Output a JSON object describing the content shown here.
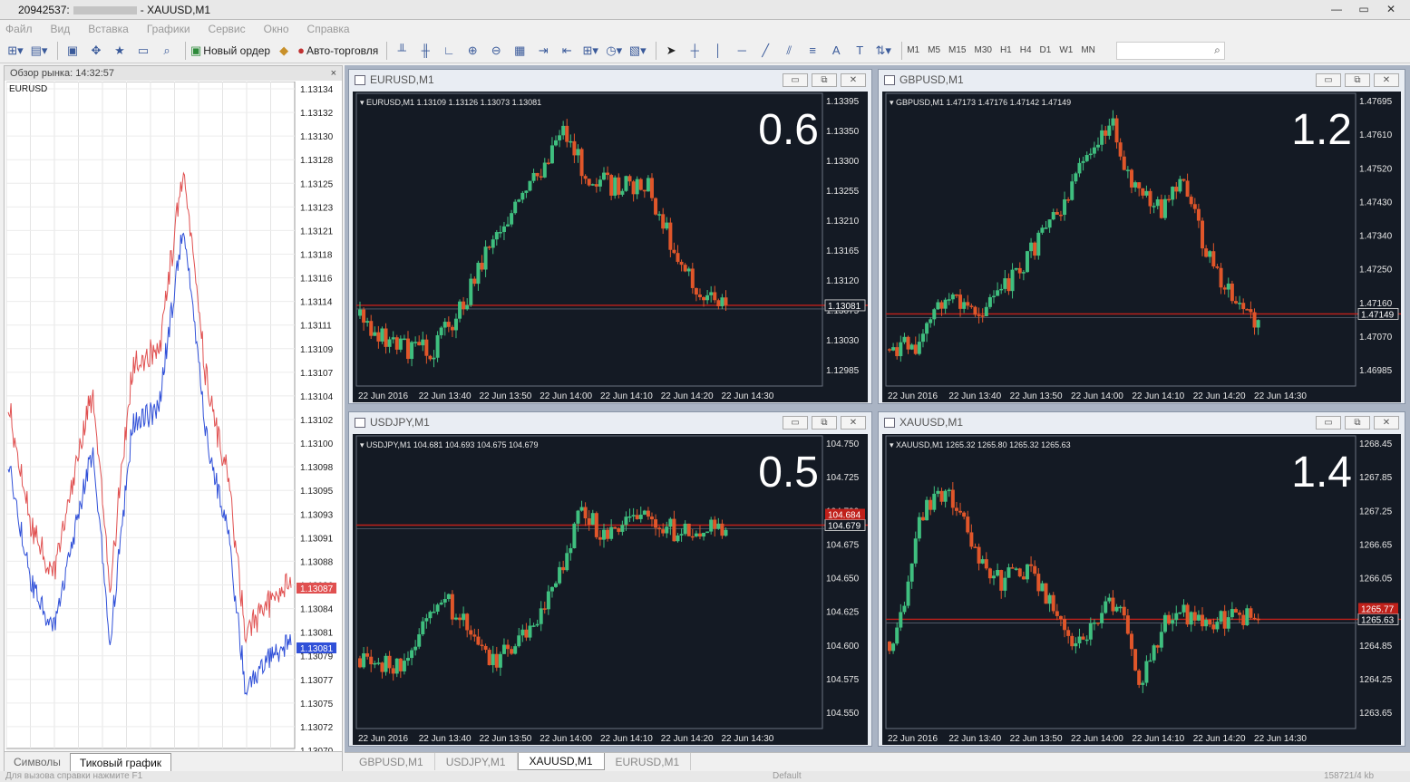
{
  "window": {
    "title_account": "20942537:",
    "title_separator": "-",
    "title_symbol": "XAUUSD,M1",
    "minimize": "—",
    "restore": "▭",
    "close": "✕"
  },
  "menu": [
    "Файл",
    "Вид",
    "Вставка",
    "Графики",
    "Сервис",
    "Окно",
    "Справка"
  ],
  "toolbar": {
    "new_order": "Новый ордер",
    "autotrading": "Авто-торговля",
    "timeframes": [
      "M1",
      "M5",
      "M15",
      "M30",
      "H1",
      "H4",
      "D1",
      "W1",
      "MN"
    ]
  },
  "market_watch": {
    "header": "Обзор рынка: 14:32:57",
    "close": "×",
    "symbol": "EURUSD",
    "tabs": [
      "Символы",
      "Тиковый график"
    ],
    "active_tab": 1,
    "price_labels": [
      "1.13134",
      "1.13132",
      "1.13130",
      "1.13128",
      "1.13125",
      "1.13123",
      "1.13121",
      "1.13118",
      "1.13116",
      "1.13114",
      "1.13111",
      "1.13109",
      "1.13107",
      "1.13104",
      "1.13102",
      "1.13100",
      "1.13098",
      "1.13095",
      "1.13093",
      "1.13091",
      "1.13088",
      "1.13086",
      "1.13084",
      "1.13081",
      "1.13079",
      "1.13077",
      "1.13075",
      "1.13072",
      "1.13070"
    ],
    "ask_tag": "1.13087",
    "bid_tag": "1.13081",
    "ask_color": "#e05050",
    "bid_color": "#3050d8"
  },
  "colors": {
    "chart_bg": "#141a24",
    "bull": "#3fbf7f",
    "bear": "#e0562a",
    "level_line": "#c0201a",
    "axis_text": "#e8e8e8",
    "spread_bg": "#c0201a"
  },
  "charts": [
    {
      "title": "EURUSD,M1",
      "info": "▾ EURUSD,M1  1.13109 1.13126 1.13073 1.13081",
      "spread": "0.6",
      "current": "1.13081",
      "current2": "",
      "prices": [
        "1.13395",
        "1.13350",
        "1.13300",
        "1.13255",
        "1.13210",
        "1.13165",
        "1.13120",
        "1.13075",
        "1.13030",
        "1.12985"
      ],
      "times": [
        "22 Jun 2016",
        "22 Jun 13:40",
        "22 Jun 13:50",
        "22 Jun 14:00",
        "22 Jun 14:10",
        "22 Jun 14:20",
        "22 Jun 14:30"
      ],
      "seed": 3
    },
    {
      "title": "GBPUSD,M1",
      "info": "▾ GBPUSD,M1  1.47173 1.47176 1.47142 1.47149",
      "spread": "1.2",
      "current": "1.47149",
      "current2": "",
      "prices": [
        "1.47695",
        "1.47610",
        "1.47520",
        "1.47430",
        "1.47340",
        "1.47250",
        "1.47160",
        "1.47070",
        "1.46985"
      ],
      "times": [
        "22 Jun 2016",
        "22 Jun 13:40",
        "22 Jun 13:50",
        "22 Jun 14:00",
        "22 Jun 14:10",
        "22 Jun 14:20",
        "22 Jun 14:30"
      ],
      "seed": 7
    },
    {
      "title": "USDJPY,M1",
      "info": "▾ USDJPY,M1  104.681 104.693 104.675 104.679",
      "spread": "0.5",
      "current": "104.679",
      "current2": "104.684",
      "prices": [
        "104.750",
        "104.725",
        "104.700",
        "104.675",
        "104.650",
        "104.625",
        "104.600",
        "104.575",
        "104.550"
      ],
      "times": [
        "22 Jun 2016",
        "22 Jun 13:40",
        "22 Jun 13:50",
        "22 Jun 14:00",
        "22 Jun 14:10",
        "22 Jun 14:20",
        "22 Jun 14:30"
      ],
      "seed": 11
    },
    {
      "title": "XAUUSD,M1",
      "info": "▾ XAUUSD,M1  1265.32 1265.80 1265.32 1265.63",
      "spread": "1.4",
      "current": "1265.63",
      "current2": "1265.77",
      "prices": [
        "1268.45",
        "1267.85",
        "1267.25",
        "1266.65",
        "1266.05",
        "1265.45",
        "1264.85",
        "1264.25",
        "1263.65"
      ],
      "times": [
        "22 Jun 2016",
        "22 Jun 13:40",
        "22 Jun 13:50",
        "22 Jun 14:00",
        "22 Jun 14:10",
        "22 Jun 14:20",
        "22 Jun 14:30"
      ],
      "seed": 17
    }
  ],
  "window_tabs": [
    "GBPUSD,M1",
    "USDJPY,M1",
    "XAUUSD,M1",
    "EURUSD,M1"
  ],
  "active_window_tab": 2,
  "status": {
    "help": "Для вызова справки нажмите F1",
    "profile": "Default",
    "traffic": "158721/4 kb"
  }
}
